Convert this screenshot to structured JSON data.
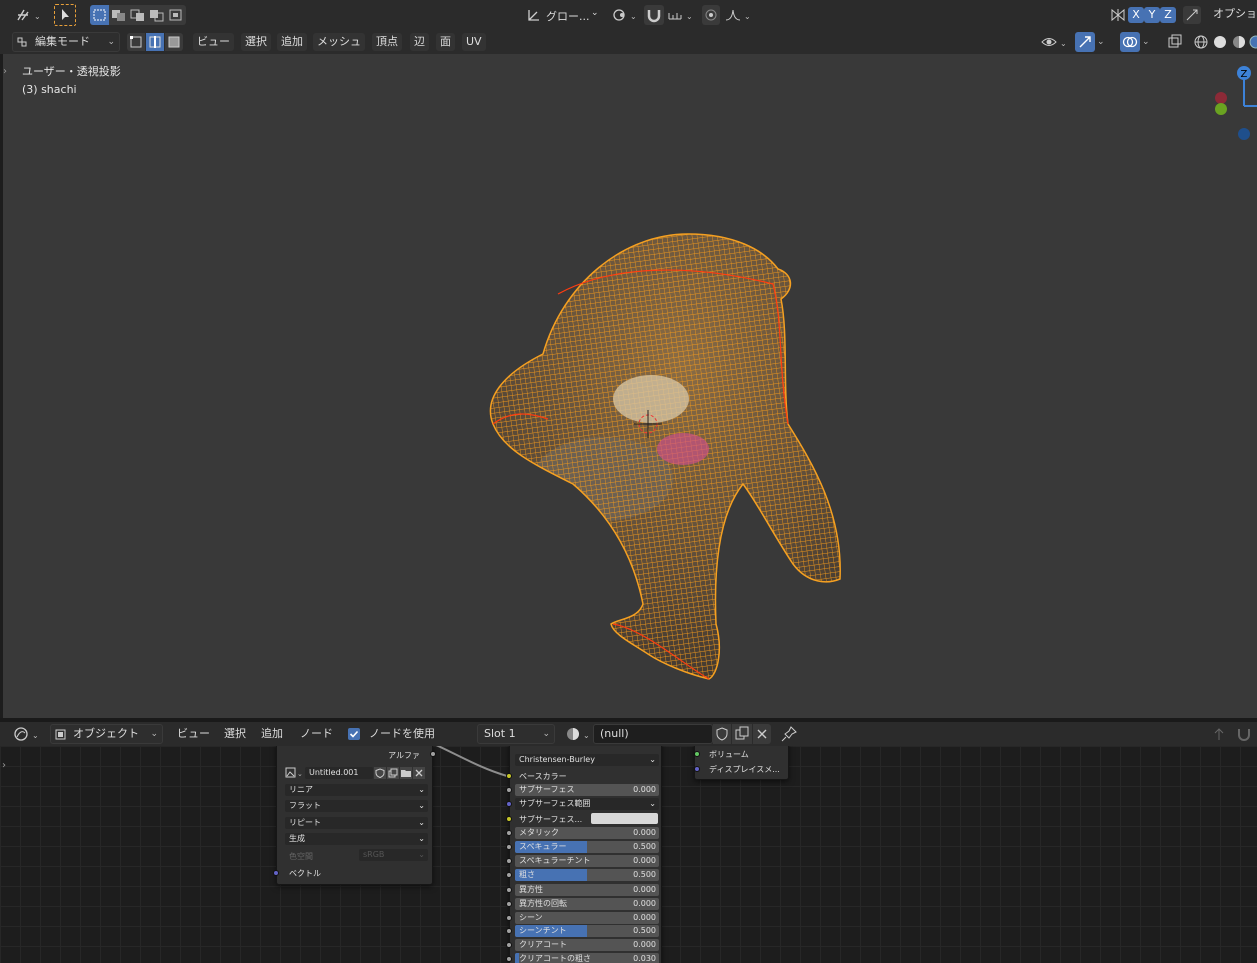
{
  "colors": {
    "accent": "#4772b3",
    "wire": "#ff9a1e",
    "selected_edge": "#ff3c10"
  },
  "topbar": {
    "transform_orientation": "グロー...",
    "axis_x": "X",
    "axis_y": "Y",
    "axis_z": "Z",
    "options": "オプショ"
  },
  "viewport_header": {
    "mode": "編集モード",
    "menu": [
      "ビュー",
      "選択",
      "追加",
      "メッシュ",
      "頂点",
      "辺",
      "面",
      "UV"
    ]
  },
  "viewport": {
    "view_name": "ユーザー・透視投影",
    "object_name": "(3) shachi"
  },
  "node_header": {
    "object_mode": "オブジェクト",
    "menu": [
      "ビュー",
      "選択",
      "追加",
      "ノード"
    ],
    "use_nodes_label": "ノードを使用",
    "use_nodes_checked": true,
    "slot": "Slot 1",
    "material": "(null)"
  },
  "image_node": {
    "output_alpha": "アルファ",
    "image_name": "Untitled.001",
    "interpolation": "リニア",
    "projection": "フラット",
    "extension": "リピート",
    "source": "生成",
    "colorspace_label": "色空間",
    "colorspace_value": "sRGB",
    "input_vector": "ベクトル"
  },
  "bsdf_node": {
    "subsurface_method": "Christensen-Burley",
    "base_color": "ベースカラー",
    "rows": [
      {
        "label": "サブサーフェス",
        "value": "0.000",
        "fill": 0
      },
      {
        "label": "サブサーフェス範囲",
        "value": "",
        "fill": 0
      },
      {
        "label": "サブサーフェス...",
        "value": "",
        "fill": 0
      },
      {
        "label": "メタリック",
        "value": "0.000",
        "fill": 0
      },
      {
        "label": "スペキュラー",
        "value": "0.500",
        "fill": 0.5
      },
      {
        "label": "スペキュラーチント",
        "value": "0.000",
        "fill": 0
      },
      {
        "label": "粗さ",
        "value": "0.500",
        "fill": 0.5
      },
      {
        "label": "異方性",
        "value": "0.000",
        "fill": 0
      },
      {
        "label": "異方性の回転",
        "value": "0.000",
        "fill": 0
      },
      {
        "label": "シーン",
        "value": "0.000",
        "fill": 0
      },
      {
        "label": "シーンチント",
        "value": "0.500",
        "fill": 0.5
      },
      {
        "label": "クリアコート",
        "value": "0.000",
        "fill": 0
      },
      {
        "label": "クリアコートの粗さ",
        "value": "0.030",
        "fill": 0.03
      }
    ]
  },
  "output_node": {
    "volume": "ボリューム",
    "displacement": "ディスプレイスメ..."
  },
  "gizmo": {
    "z": "Z"
  }
}
